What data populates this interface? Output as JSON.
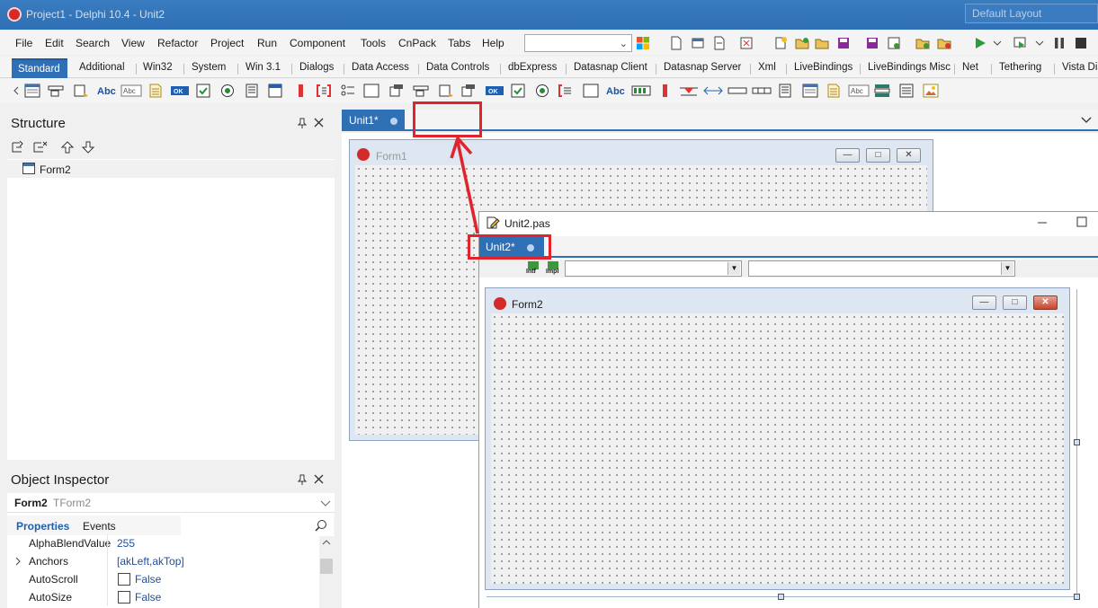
{
  "titlebar": {
    "title": "Project1 - Delphi 10.4 - Unit2",
    "layout": "Default Layout"
  },
  "menu": [
    "File",
    "Edit",
    "Search",
    "View",
    "Refactor",
    "Project",
    "Run",
    "Component",
    "Tools",
    "CnPack",
    "Tabs",
    "Help"
  ],
  "palette_tabs": [
    "Standard",
    "Additional",
    "Win32",
    "System",
    "Win 3.1",
    "Dialogs",
    "Data Access",
    "Data Controls",
    "dbExpress",
    "Datasnap Client",
    "Datasnap Server",
    "Xml",
    "LiveBindings",
    "LiveBindings Misc",
    "Net",
    "Tethering",
    "Vista Dia"
  ],
  "structure": {
    "title": "Structure",
    "tree_item": "Form2"
  },
  "object_inspector": {
    "title": "Object Inspector",
    "selected_name": "Form2",
    "selected_type": "TForm2",
    "tab_properties": "Properties",
    "tab_events": "Events",
    "rows": [
      {
        "name": "AlphaBlendValue",
        "value": "255"
      },
      {
        "name": "Anchors",
        "value": "[akLeft,akTop]"
      },
      {
        "name": "AutoScroll",
        "value": "False"
      },
      {
        "name": "AutoSize",
        "value": "False"
      }
    ]
  },
  "editor": {
    "tab": "Unit1*",
    "form1_caption": "Form1"
  },
  "unit2": {
    "file": "Unit2.pas",
    "tab": "Unit2*",
    "intf": "Intf",
    "impl": "Impl",
    "form2_caption": "Form2"
  },
  "colors": {
    "accent": "#2f6fb4",
    "highlight": "#e1232b"
  }
}
